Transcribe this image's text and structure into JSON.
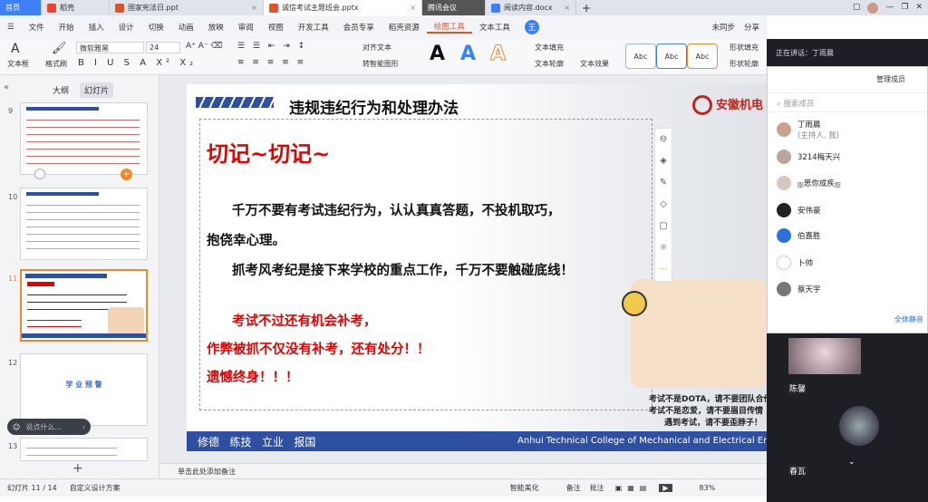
{
  "tabs": [
    {
      "label": "首页"
    },
    {
      "label": "稻壳"
    },
    {
      "label": "国家宪法日.ppt"
    },
    {
      "label": "诚信考试主题班会.pptx"
    },
    {
      "label": "腾讯会议"
    },
    {
      "label": "阅读内容.docx"
    }
  ],
  "top_right": {
    "sync": "未同步",
    "share": "分享"
  },
  "menu": {
    "file": "文件",
    "items": [
      "开始",
      "插入",
      "设计",
      "切换",
      "动画",
      "放映",
      "审阅",
      "视图",
      "开发工具",
      "会员专享",
      "稻壳资源"
    ],
    "drawing_tools": "绘图工具",
    "text_tools": "文本工具"
  },
  "ribbon": {
    "textbox": "文本框",
    "format_brush": "格式刷",
    "font": "微软雅黑",
    "size": "24",
    "align_text": "对齐文本",
    "convert_smartart": "转智能图形",
    "style_labels": [
      "A",
      "A",
      "A"
    ],
    "shape_styles": [
      "Abc",
      "Abc",
      "Abc"
    ],
    "shape_fill": "形状填充",
    "shape_outline": "形状轮廓",
    "text_fill": "文本填充",
    "text_outline": "文本轮廓",
    "text_effect": "文本效果"
  },
  "panel_tabs": {
    "outline": "大纲",
    "slides": "幻灯片"
  },
  "thumbs": [
    {
      "num": "9"
    },
    {
      "num": "10"
    },
    {
      "num": "11"
    },
    {
      "num": "12"
    },
    {
      "num": "13"
    }
  ],
  "thumb12_text": "学 业 预 警",
  "comment_placeholder": "说点什么...",
  "slide": {
    "title": "违规违纪行为和处理办法",
    "school_name": "安徽机电",
    "heading": "切记~切记~",
    "para1": "千万不要有考试违纪行为，认认真真答题，不投机取巧，",
    "para1b": "抱侥幸心理。",
    "para2": "抓考风考纪是接下来学校的重点工作，千万不要触碰底线！",
    "red1": "考试不过还有机会补考，",
    "red2": "作弊被抓不仅没有补考，还有处分！！",
    "red3": "遗憾终身！！！",
    "cartoon1": "考试不是DOTA，请不要团队合作",
    "cartoon2": "考试不是恋爱，请不要眉目传情",
    "cartoon3": "遇到考试，请不要歪脖子！",
    "footer_left": "修德   练技   立业   报国",
    "footer_right": "Anhui Technical College of Mechanical and Electrical En"
  },
  "meeting": {
    "speaking": "正在讲话：丁雨晨",
    "manage": "管理成员",
    "search_placeholder": "搜索成员",
    "members": [
      {
        "name": "丁雨晨",
        "sub": "(主持人, 我)"
      },
      {
        "name": "3214梅天兴"
      },
      {
        "name": "ஐ思你成疾ஐ"
      },
      {
        "name": "安伟豪"
      },
      {
        "name": "伯嘉胜"
      },
      {
        "name": "卜帅"
      },
      {
        "name": "蔡天宇"
      }
    ],
    "mute_all": "全体静音",
    "video1": "陈馨",
    "video2": "春瓦"
  },
  "notes": "单击此处添加备注",
  "status": {
    "slide": "幻灯片 11 / 14",
    "theme": "自定义设计方案",
    "beautify": "智能美化",
    "notes": "备注",
    "comments": "批注",
    "zoom": "83%"
  },
  "colors": {
    "accent": "#3d7ff5",
    "red": "#e60000",
    "orange": "#f0862d",
    "footer": "#2f4fa0"
  }
}
